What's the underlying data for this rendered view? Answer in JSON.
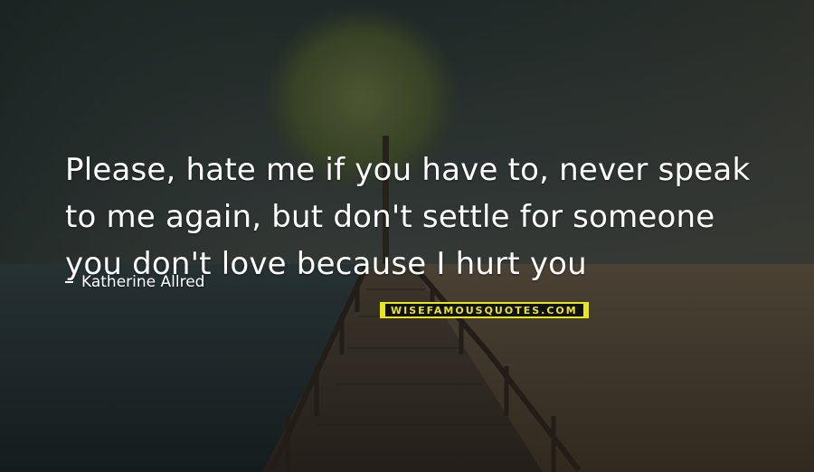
{
  "quote": {
    "lines": [
      "Please, hate me if you have to, never speak",
      "to me again, but don't settle for someone",
      "you don't love because I hurt you"
    ],
    "author": "Katherine Allred"
  },
  "watermark": {
    "text": "WISEFAMOUSQUOTES.COM"
  },
  "colors": {
    "text": "#ffffff",
    "watermark": "#e8e619"
  }
}
